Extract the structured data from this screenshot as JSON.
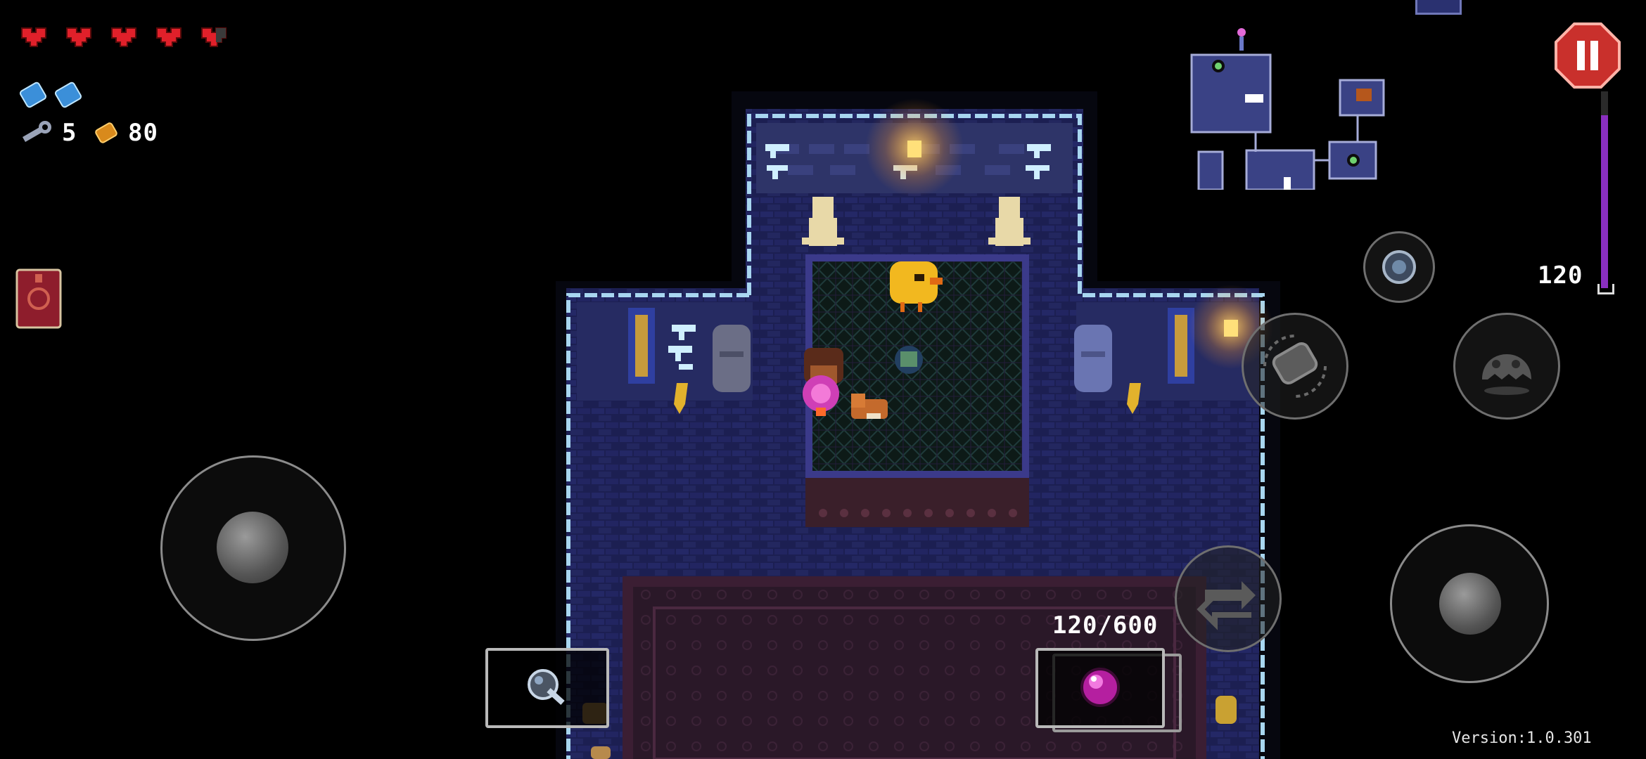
{
  "hud": {
    "hearts_full": 4,
    "hearts_total": 5,
    "blanks_count": 2,
    "keys_value": "5",
    "shells_value": "80",
    "minimap_label": "",
    "version_text": "Version:1.0.301"
  },
  "weapon": {
    "ammo_text": "120/600",
    "reserve_text": "120",
    "item_slot_icon": "glass-guon-icon",
    "weapon_slot_icon": "magenta-orb-gun-icon"
  },
  "icons": {
    "ammonomicon": "red-book-icon",
    "pause": "pause-icon",
    "reload": "reload-icon",
    "interact": "ghost-interact-icon",
    "dodge": "dodge-roll-icon",
    "swap": "swap-weapon-icon",
    "blank": "blank-icon",
    "key": "key-icon",
    "shell": "shell-currency-icon"
  },
  "colors": {
    "heart": "#e0202a",
    "pause_red": "#c9302c",
    "wall_blue": "#2a3170",
    "floor_purple": "#1a1b4a",
    "rail": "#a8d6f0",
    "ammo_bar": "#8a2fc0"
  }
}
